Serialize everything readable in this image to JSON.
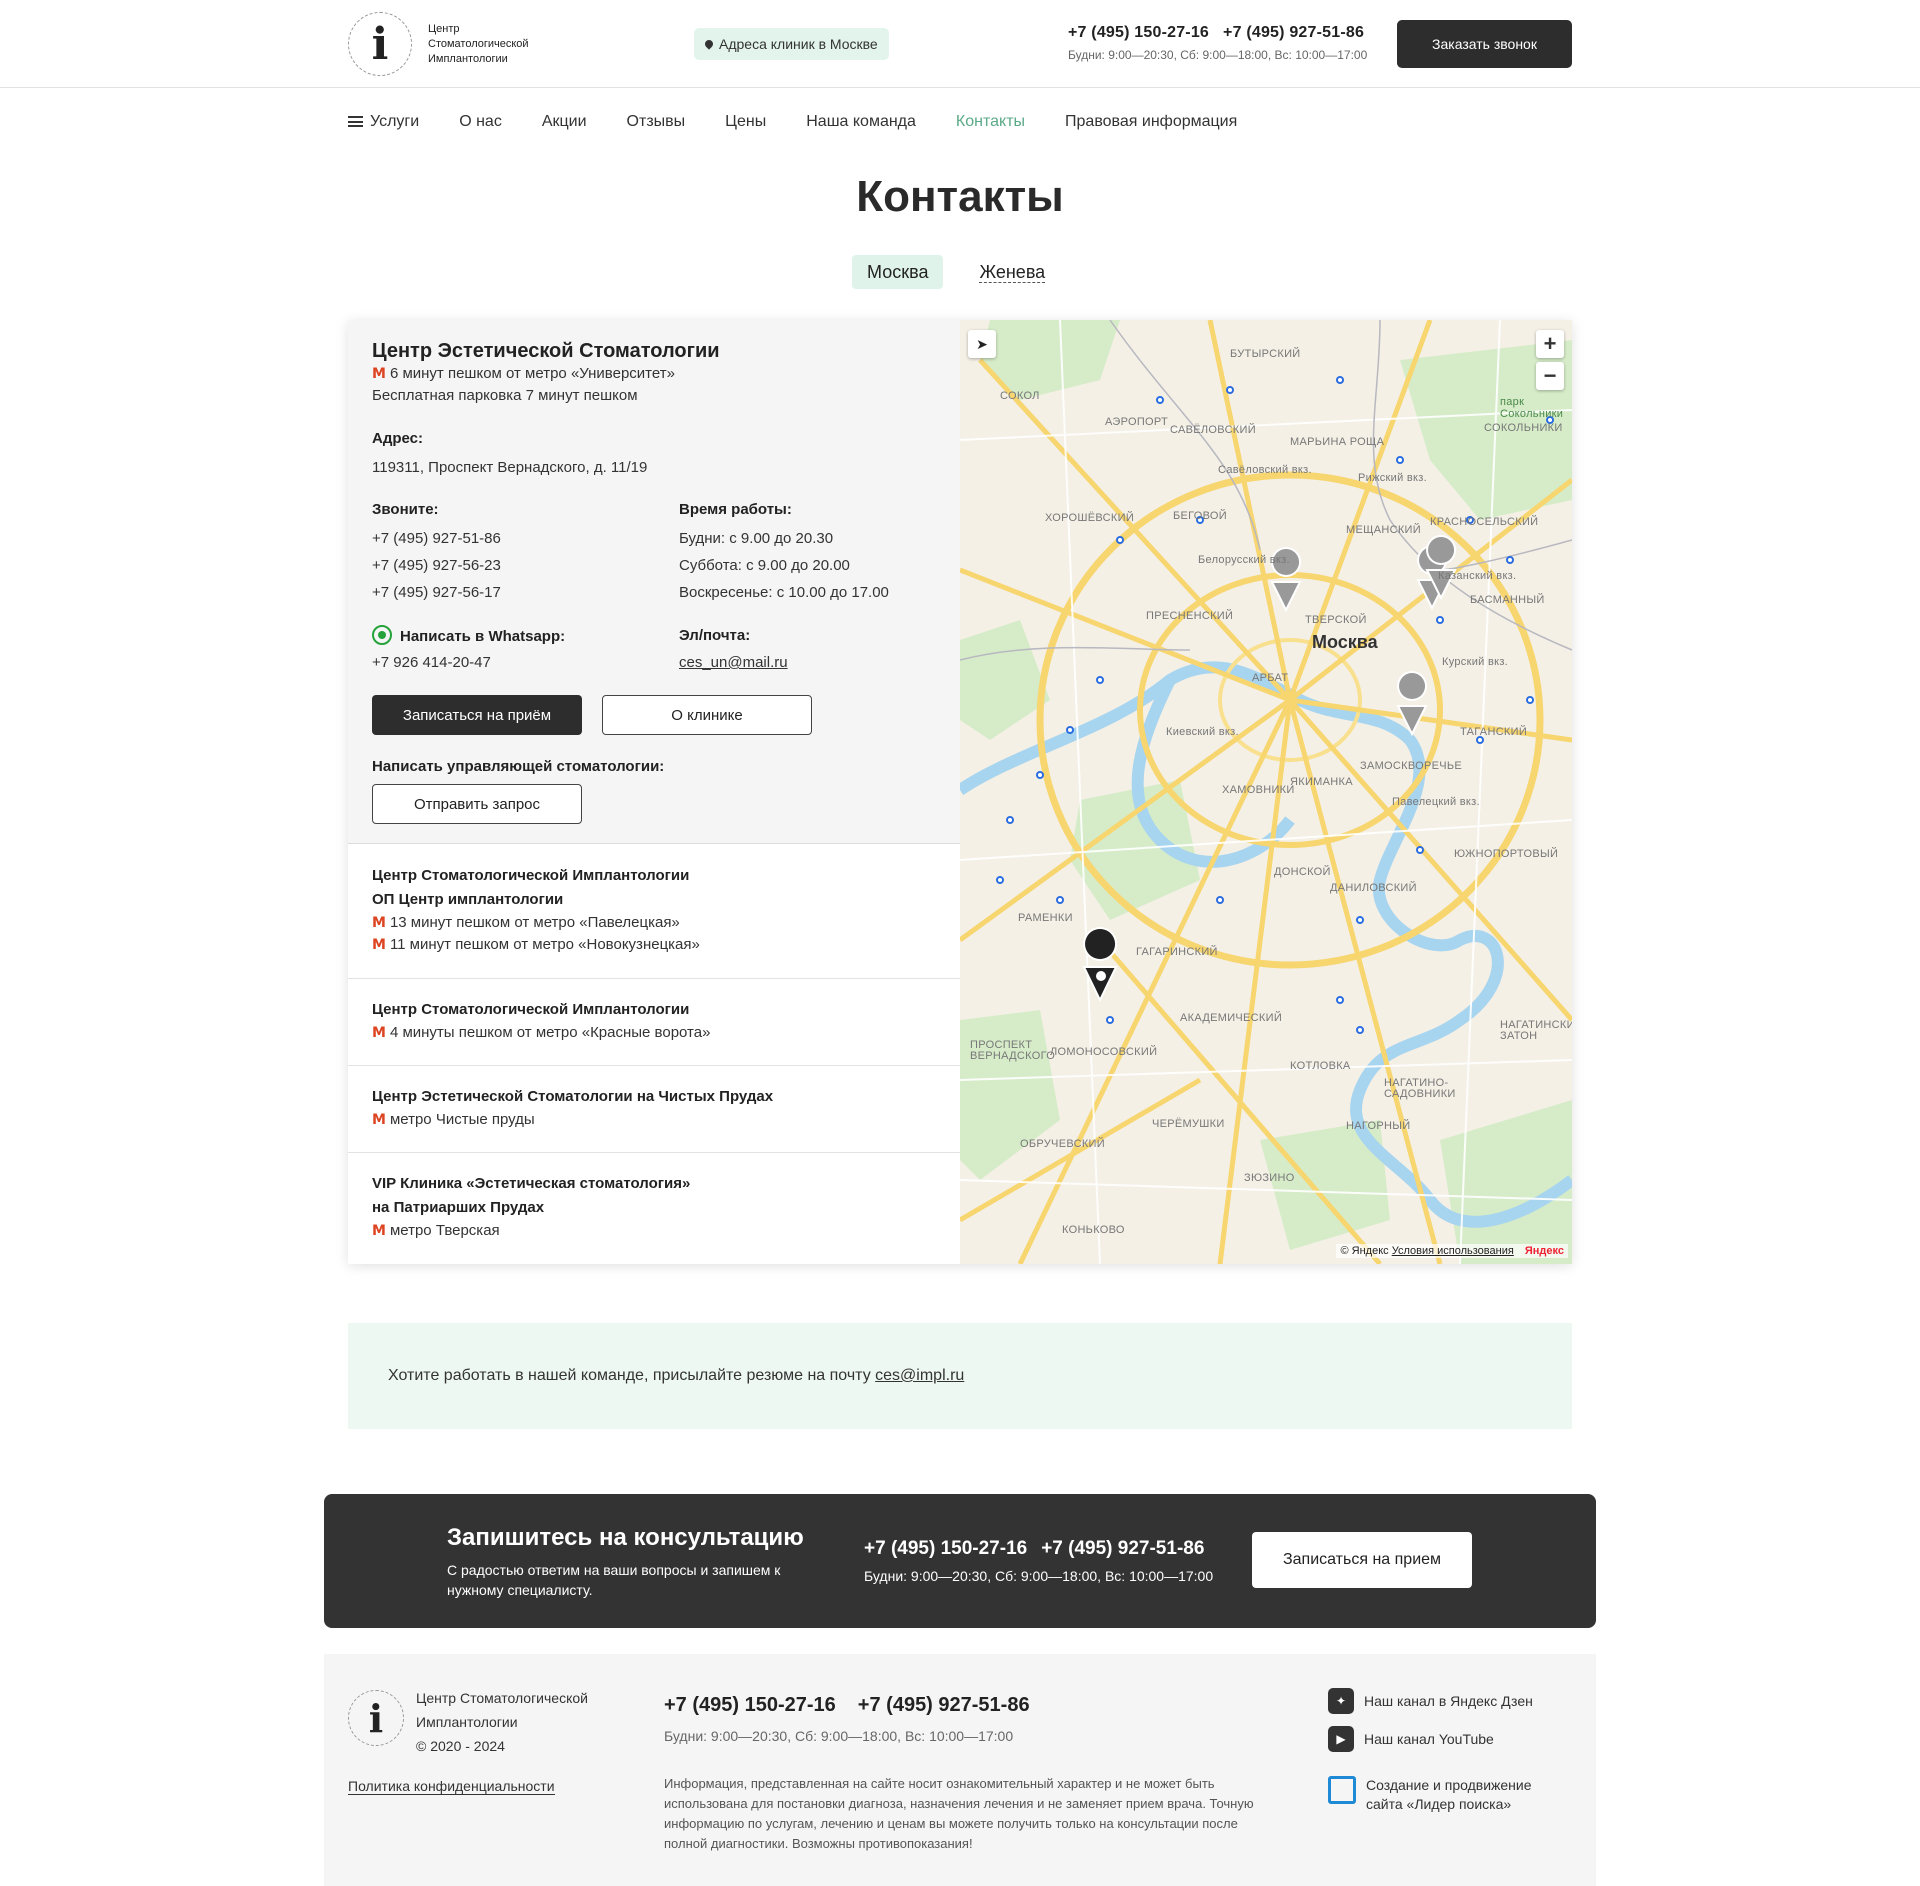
{
  "header": {
    "logo_text": "Центр Стоматологической Имплантологии",
    "address_pill": "Адреса клиник в Москве",
    "phones": [
      "+7 (495) 150-27-16",
      "+7 (495) 927-51-86"
    ],
    "hours": "Будни: 9:00—20:30, Сб: 9:00—18:00, Вс: 10:00—17:00",
    "call_button": "Заказать звонок"
  },
  "nav": {
    "items": [
      "Услуги",
      "О нас",
      "Акции",
      "Отзывы",
      "Цены",
      "Наша команда",
      "Контакты",
      "Правовая информация"
    ],
    "active": "Контакты"
  },
  "page_title": "Контакты",
  "city_tabs": [
    "Москва",
    "Женева"
  ],
  "active_clinic": {
    "name": "Центр Эстетической Стоматологии",
    "metro": "6 минут пешком от метро «Университет»",
    "parking": "Бесплатная парковка 7 минут пешком",
    "address_label": "Адрес:",
    "address": "119311, Проспект Вернадского, д. 11/19",
    "phones_label": "Звоните:",
    "phones": [
      "+7 (495) 927-51-86",
      "+7 (495) 927-56-23",
      "+7 (495) 927-56-17"
    ],
    "hours_label": "Время работы:",
    "hours": [
      "Будни: с 9.00 до 20.30",
      "Суббота: с 9.00 до 20.00",
      "Воскресенье: с 10.00 до 17.00"
    ],
    "whatsapp_label": "Написать в Whatsapp:",
    "whatsapp": "+7 926 414-20-47",
    "email_label": "Эл/почта:",
    "email": "ces_un@mail.ru",
    "book_button": "Записаться на приём",
    "about_button": "О клинике",
    "manager_label": "Написать управляющей стоматологии:",
    "request_button": "Отправить запрос"
  },
  "clinics": [
    {
      "title": [
        "Центр Стоматологической Имплантологии",
        "ОП Центр имплантологии"
      ],
      "metro": [
        "13 минут пешком от метро «Павелецкая»",
        "11 минут пешком от метро «Новокузнецкая»"
      ]
    },
    {
      "title": [
        "Центр Стоматологической Имплантологии"
      ],
      "metro": [
        "4 минуты пешком от метро «Красные ворота»"
      ]
    },
    {
      "title": [
        "Центр Эстетической Стоматологии на Чистых Прудах"
      ],
      "metro": [
        "метро Чистые пруды"
      ]
    },
    {
      "title": [
        "VIP Клиника «Эстетическая стоматология»",
        "на Патриарших Прудах"
      ],
      "metro": [
        "метро Тверская"
      ]
    }
  ],
  "map": {
    "city": "Москва",
    "zoom_in": "+",
    "zoom_out": "−",
    "copyright": "© Яндекс",
    "terms": "Условия использования",
    "brand": "Яндекс",
    "labels": [
      "БУТЫРСКИЙ",
      "СОКОЛ",
      "АЭРОПОРТ",
      "САВЁЛОВСКИЙ",
      "МАРЬИНА РОЩА",
      "Савёловский вкз.",
      "Рижский вкз.",
      "СОКОЛЬНИКИ",
      "ХОРОШЁВСКИЙ",
      "БЕГОВОЙ",
      "МЕЩАНСКИЙ",
      "КРАСНОСЕЛЬСКИЙ",
      "Белорусский вкз.",
      "Казанский вкз.",
      "БАСМАННЫЙ",
      "ПРЕСНЕНСКИЙ",
      "ТВЕРСКОЙ",
      "АРБАТ",
      "Курский вкз.",
      "Киевский вкз.",
      "ТАГАНСКИЙ",
      "ХАМОВНИКИ",
      "ЯКИМАНКА",
      "ЗАМОСКВОРЕЧЬЕ",
      "Павелецкий вкз.",
      "ДОНСКОЙ",
      "ДАНИЛОВСКИЙ",
      "ЮЖНОПОРТОВЫЙ",
      "РАМЕНКИ",
      "ГАГАРИНСКИЙ",
      "АКАДЕМИЧЕСКИЙ",
      "ЛОМОНОСОВСКИЙ",
      "ПРОСПЕКТ ВЕРНАДСКОГО",
      "КОТЛОВКА",
      "НАГАТИНО-САДОВНИКИ",
      "НАГАТИНСКИЙ ЗАТОН",
      "ЧЕРЁМУШКИ",
      "ОБРУЧЕВСКИЙ",
      "НАГОРНЫЙ",
      "ЗЮЗИНО",
      "КОНЬКОВО",
      "парк Сокольники"
    ],
    "park_label": "парк Сокольники"
  },
  "resume": {
    "text": "Хотите работать в нашей команде, присылайте резюме на почту ",
    "email": "ces@impl.ru"
  },
  "cta": {
    "title": "Запишитесь на консультацию",
    "subtitle": "С радостью ответим на ваши вопросы и запишем к нужному специалисту.",
    "phones": [
      "+7 (495) 150-27-16",
      "+7 (495) 927-51-86"
    ],
    "hours": "Будни: 9:00—20:30, Сб: 9:00—18:00, Вс: 10:00—17:00",
    "button": "Записаться на прием"
  },
  "footer": {
    "name": "Центр Стоматологической Имплантологии",
    "copyright": "© 2020 - 2024",
    "policy": "Политика конфиденциальности",
    "phones": [
      "+7 (495) 150-27-16",
      "+7 (495) 927-51-86"
    ],
    "hours": "Будни: 9:00—20:30, Сб: 9:00—18:00, Вс: 10:00—17:00",
    "disclaimer": "Информация, представленная на сайте носит ознакомительный характер и не может быть использована для постановки диагноза, назначения лечения и не заменяет прием врача. Точную информацию по услугам, лечению и ценам вы можете получить только на консультации после полной диагностики. Возможны противопоказания!",
    "zen": "Наш канал в Яндекс Дзен",
    "youtube": "Наш канал YouTube",
    "lider": "Создание и продвижение сайта «Лидер поиска»"
  },
  "colors": {
    "accent": "#5aa987",
    "dark": "#2d2d2d",
    "pill_bg": "#e3f4ec",
    "metro_red": "#d42222"
  }
}
